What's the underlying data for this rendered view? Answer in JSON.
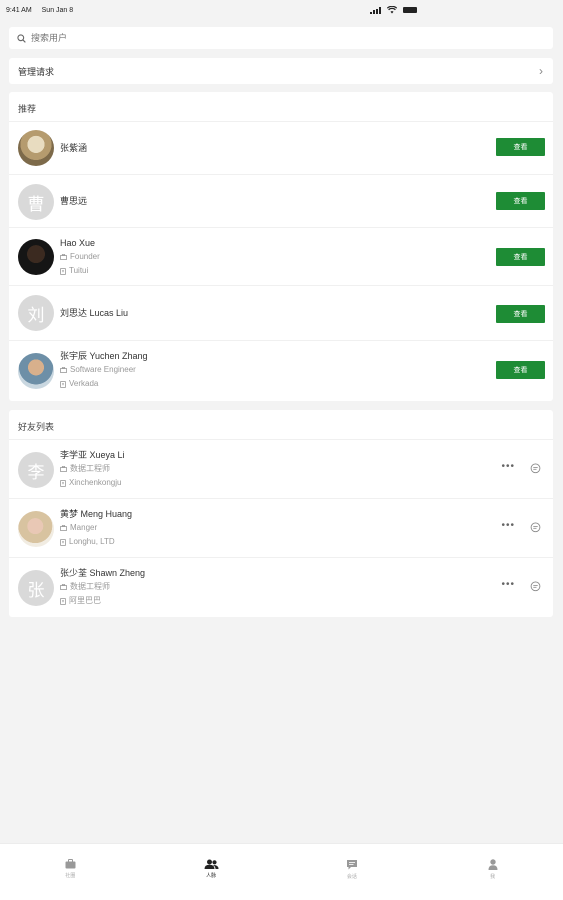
{
  "status_bar": {
    "time": "9:41 AM",
    "date": "Sun Jan 8"
  },
  "search": {
    "placeholder": "搜索用户"
  },
  "manage": {
    "label": "管理请求",
    "chevron": "›"
  },
  "recommend": {
    "title": "推荐",
    "button_label": "查看",
    "items": [
      {
        "name": "张紫涵",
        "avatar": "photo",
        "position": "",
        "company": ""
      },
      {
        "name": "曹思远",
        "avatar_char": "曹",
        "position": "",
        "company": ""
      },
      {
        "name": "Hao Xue",
        "avatar": "photo",
        "position": "Founder",
        "company": "Tuitui"
      },
      {
        "name": "刘思达 Lucas Liu",
        "avatar_char": "刘",
        "position": "",
        "company": ""
      },
      {
        "name": "张宇辰 Yuchen Zhang",
        "avatar": "photo",
        "position": "Software Engineer",
        "company": "Verkada"
      }
    ]
  },
  "friends": {
    "title": "好友列表",
    "more_label": "•••",
    "items": [
      {
        "name": "李学亚 Xueya Li",
        "avatar_char": "李",
        "position": "数据工程师",
        "company": "Xinchenkongju"
      },
      {
        "name": "黄梦 Meng Huang",
        "avatar": "photo",
        "position": "Manger",
        "company": "Longhu, LTD"
      },
      {
        "name": "张少荃 Shawn Zheng",
        "avatar_char": "张",
        "position": "数据工程师",
        "company": "阿里巴巴"
      }
    ]
  },
  "tabbar": {
    "items": [
      {
        "label": "社圈",
        "icon": "briefcase-icon"
      },
      {
        "label": "人脉",
        "icon": "people-icon"
      },
      {
        "label": "会话",
        "icon": "chat-icon"
      },
      {
        "label": "我",
        "icon": "person-icon"
      }
    ]
  },
  "colors": {
    "accent": "#1e8c35",
    "background": "#f3f3f3"
  }
}
